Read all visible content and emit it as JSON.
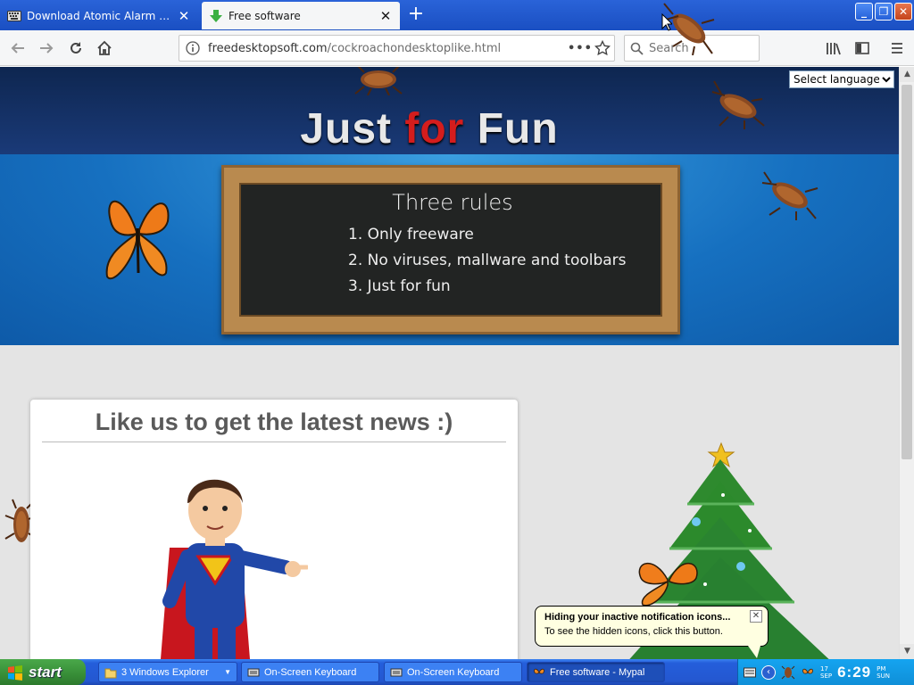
{
  "browser": {
    "tabs": [
      {
        "title": "Download Atomic Alarm Clock - Co",
        "active": false
      },
      {
        "title": "Free software",
        "active": true
      }
    ],
    "url_domain": "freedesktopsoft.com",
    "url_path": "/cockroachondesktoplike.html",
    "search_placeholder": "Search",
    "page_actions_label": "•••"
  },
  "page": {
    "language_select": "Select language",
    "hero_title": {
      "word1": "Just",
      "word2": "for",
      "word3": "Fun"
    },
    "chalkboard": {
      "title": "Three rules",
      "rules": [
        "1. Only freeware",
        "2. No viruses, mallware and toolbars",
        "3. Just for fun"
      ]
    },
    "news_title": "Like us to get the latest news :)"
  },
  "balloon": {
    "title": "Hiding your inactive notification icons...",
    "text": "To see the hidden icons, click this button."
  },
  "taskbar": {
    "start_label": "start",
    "tasks": [
      {
        "label": "3 Windows Explorer"
      },
      {
        "label": "On-Screen Keyboard"
      },
      {
        "label": "On-Screen Keyboard"
      },
      {
        "label": "Free software - Mypal"
      }
    ],
    "clock": {
      "date_day": "17",
      "date_month": "SEP",
      "time": "6:29",
      "ampm": "PM",
      "weekday": "SUN"
    }
  },
  "colors": {
    "xp_taskbar": "#245edb",
    "tab_bar": "#2a63d8",
    "hero_blue": "#1670c0",
    "fun_red": "#d41d1d"
  }
}
